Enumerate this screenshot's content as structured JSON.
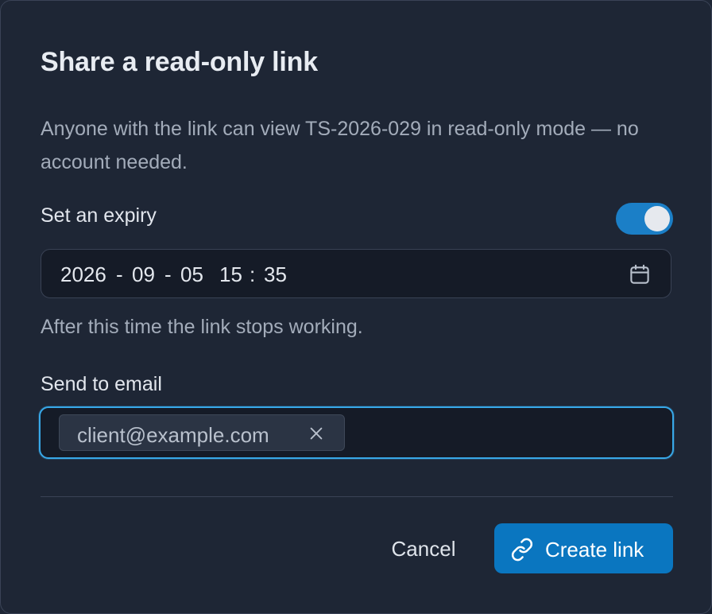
{
  "dialog": {
    "title": "Share a read-only link",
    "description": "Anyone with the link can view TS-2026-029 in read-only mode — no account needed."
  },
  "expiry": {
    "label": "Set an expiry",
    "enabled": true,
    "date_year": "2026",
    "date_month": "09",
    "date_day": "05",
    "time_hour": "15",
    "time_minute": "35",
    "sep_dash": "-",
    "sep_colon": ":",
    "hint": "After this time the link stops working.",
    "calendar_icon": "calendar-icon"
  },
  "email": {
    "label": "Send to email",
    "chips": [
      "client@example.com"
    ],
    "remove_icon": "close-icon"
  },
  "actions": {
    "cancel_label": "Cancel",
    "create_label": "Create link",
    "create_icon": "link-icon"
  },
  "colors": {
    "background": "#1e2635",
    "accent": "#0a76c0",
    "focus_ring": "#38a8e8",
    "toggle_on": "#1b7fc7"
  }
}
